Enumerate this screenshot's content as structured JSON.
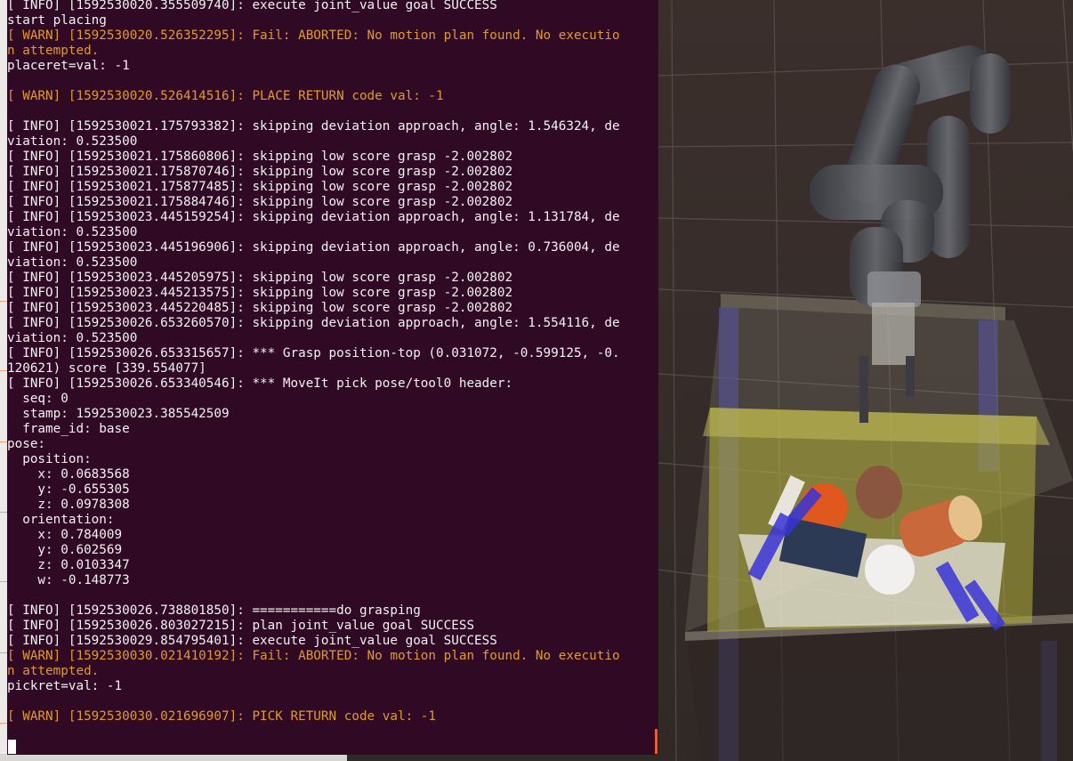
{
  "terminal": {
    "lines": [
      {
        "text": "[ INFO] [1592530020.355509740]: execute joint_value goal SUCCESS",
        "level": "info"
      },
      {
        "text": "start placing",
        "level": "info"
      },
      {
        "text": "[ WARN] [1592530020.526352295]: Fail: ABORTED: No motion plan found. No executio",
        "level": "warn"
      },
      {
        "text": "n attempted.",
        "level": "warn"
      },
      {
        "text": "placeret=val: -1",
        "level": "info"
      },
      {
        "text": "",
        "level": "info"
      },
      {
        "text": "[ WARN] [1592530020.526414516]: PLACE RETURN code val: -1",
        "level": "warn"
      },
      {
        "text": "",
        "level": "info"
      },
      {
        "text": "[ INFO] [1592530021.175793382]: skipping deviation approach, angle: 1.546324, de",
        "level": "info"
      },
      {
        "text": "viation: 0.523500",
        "level": "info"
      },
      {
        "text": "[ INFO] [1592530021.175860806]: skipping low score grasp -2.002802",
        "level": "info"
      },
      {
        "text": "[ INFO] [1592530021.175870746]: skipping low score grasp -2.002802",
        "level": "info"
      },
      {
        "text": "[ INFO] [1592530021.175877485]: skipping low score grasp -2.002802",
        "level": "info"
      },
      {
        "text": "[ INFO] [1592530021.175884746]: skipping low score grasp -2.002802",
        "level": "info"
      },
      {
        "text": "[ INFO] [1592530023.445159254]: skipping deviation approach, angle: 1.131784, de",
        "level": "info"
      },
      {
        "text": "viation: 0.523500",
        "level": "info"
      },
      {
        "text": "[ INFO] [1592530023.445196906]: skipping deviation approach, angle: 0.736004, de",
        "level": "info"
      },
      {
        "text": "viation: 0.523500",
        "level": "info"
      },
      {
        "text": "[ INFO] [1592530023.445205975]: skipping low score grasp -2.002802",
        "level": "info"
      },
      {
        "text": "[ INFO] [1592530023.445213575]: skipping low score grasp -2.002802",
        "level": "info"
      },
      {
        "text": "[ INFO] [1592530023.445220485]: skipping low score grasp -2.002802",
        "level": "info"
      },
      {
        "text": "[ INFO] [1592530026.653260570]: skipping deviation approach, angle: 1.554116, de",
        "level": "info"
      },
      {
        "text": "viation: 0.523500",
        "level": "info"
      },
      {
        "text": "[ INFO] [1592530026.653315657]: *** Grasp position-top (0.031072, -0.599125, -0.",
        "level": "info"
      },
      {
        "text": "120621) score [339.554077]",
        "level": "info"
      },
      {
        "text": "[ INFO] [1592530026.653340546]: *** MoveIt pick pose/tool0 header:",
        "level": "info"
      },
      {
        "text": "  seq: 0",
        "level": "info"
      },
      {
        "text": "  stamp: 1592530023.385542509",
        "level": "info"
      },
      {
        "text": "  frame_id: base",
        "level": "info"
      },
      {
        "text": "pose:",
        "level": "info"
      },
      {
        "text": "  position:",
        "level": "info"
      },
      {
        "text": "    x: 0.0683568",
        "level": "info"
      },
      {
        "text": "    y: -0.655305",
        "level": "info"
      },
      {
        "text": "    z: 0.0978308",
        "level": "info"
      },
      {
        "text": "  orientation:",
        "level": "info"
      },
      {
        "text": "    x: 0.784009",
        "level": "info"
      },
      {
        "text": "    y: 0.602569",
        "level": "info"
      },
      {
        "text": "    z: 0.0103347",
        "level": "info"
      },
      {
        "text": "    w: -0.148773",
        "level": "info"
      },
      {
        "text": "",
        "level": "info"
      },
      {
        "text": "[ INFO] [1592530026.738801850]: ===========do grasping",
        "level": "info"
      },
      {
        "text": "[ INFO] [1592530026.803027215]: plan joint_value goal SUCCESS",
        "level": "info"
      },
      {
        "text": "[ INFO] [1592530029.854795401]: execute joint_value goal SUCCESS",
        "level": "info"
      },
      {
        "text": "[ WARN] [1592530030.021410192]: Fail: ABORTED: No motion plan found. No executio",
        "level": "warn"
      },
      {
        "text": "n attempted.",
        "level": "warn"
      },
      {
        "text": "pickret=val: -1",
        "level": "info"
      },
      {
        "text": "",
        "level": "info"
      },
      {
        "text": "[ WARN] [1592530030.021696907]: PICK RETURN code val: -1",
        "level": "warn"
      }
    ]
  },
  "colors": {
    "terminal_background": "#300a24",
    "info_text": "#f2f2f2",
    "warn_text": "#e09a2d",
    "scene_background": "#3a3330"
  },
  "scene": {
    "view": "3d-robot-viewport",
    "robot": "robot-arm-icon",
    "table": "table-icon",
    "objects": [
      "tomato-icon",
      "mannequin-head-icon",
      "can-icon",
      "circuit-board-icon",
      "gear-icon"
    ]
  }
}
